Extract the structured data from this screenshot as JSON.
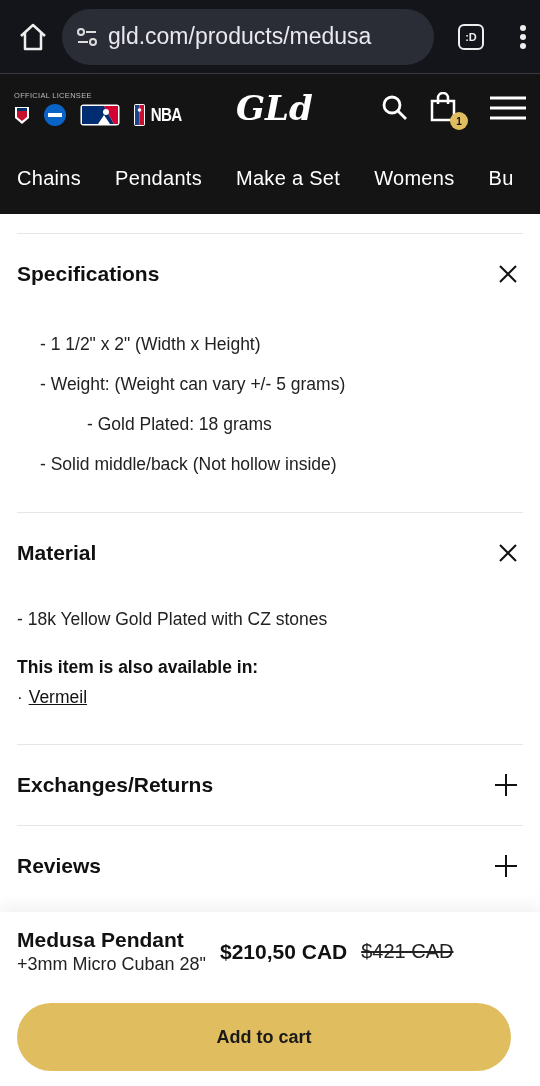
{
  "browser": {
    "url": "gld.com/products/medusa",
    "tab_label": ":D"
  },
  "header": {
    "licensee_label": "OFFICIAL LICENSEE",
    "league_text": "NBA",
    "logo": "GLd",
    "cart_count": "1"
  },
  "nav": [
    {
      "label": "Chains"
    },
    {
      "label": "Pendants"
    },
    {
      "label": "Make a Set"
    },
    {
      "label": "Womens"
    },
    {
      "label": "Bu"
    }
  ],
  "sections": [
    {
      "title": "Specifications",
      "expanded": true,
      "kind": "list",
      "items": [
        {
          "text": "- 1 1/2\" x 2\" (Width x Height)"
        },
        {
          "text": "- Weight: (Weight can vary +/- 5 grams)",
          "children": [
            {
              "text": "- Gold Plated: 18 grams"
            }
          ]
        },
        {
          "text": "- Solid middle/back (Not hollow inside)"
        }
      ]
    },
    {
      "title": "Material",
      "expanded": true,
      "kind": "text",
      "text": "- 18k Yellow Gold Plated with CZ stones",
      "also_label": "This item is also available in:",
      "bullet": "·",
      "link": "Vermeil"
    },
    {
      "title": "Exchanges/Returns",
      "expanded": false
    },
    {
      "title": "Reviews",
      "expanded": false
    }
  ],
  "product": {
    "name": "Medusa Pendant",
    "variant": "+3mm Micro Cuban 28\"",
    "price": "$210,50 CAD",
    "old_price": "$421 CAD",
    "button": "Add to cart"
  }
}
